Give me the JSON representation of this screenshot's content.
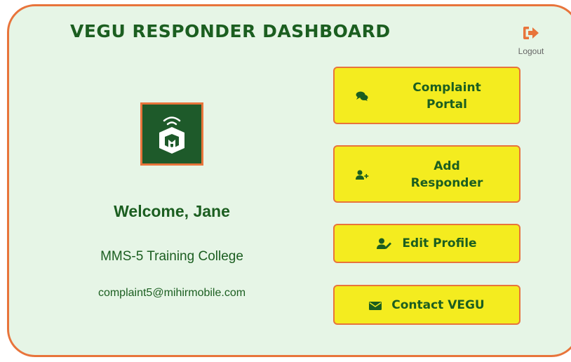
{
  "header": {
    "title": "VEGU RESPONDER DASHBOARD",
    "logout_label": "Logout"
  },
  "profile": {
    "welcome": "Welcome, Jane",
    "organization": "MMS-5 Training College",
    "email": "complaint5@mihirmobile.com"
  },
  "actions": [
    {
      "line1": "Complaint",
      "line2": "Portal",
      "icon": "comments-icon"
    },
    {
      "line1": "Add",
      "line2": "Responder",
      "icon": "user-plus-icon"
    },
    {
      "label": "Edit Profile",
      "icon": "user-edit-icon"
    },
    {
      "label": "Contact VEGU",
      "icon": "envelope-icon"
    }
  ],
  "colors": {
    "accent": "#e8743b",
    "background": "#e6f5e6",
    "button": "#f4ec1f",
    "text": "#1b5e20"
  }
}
